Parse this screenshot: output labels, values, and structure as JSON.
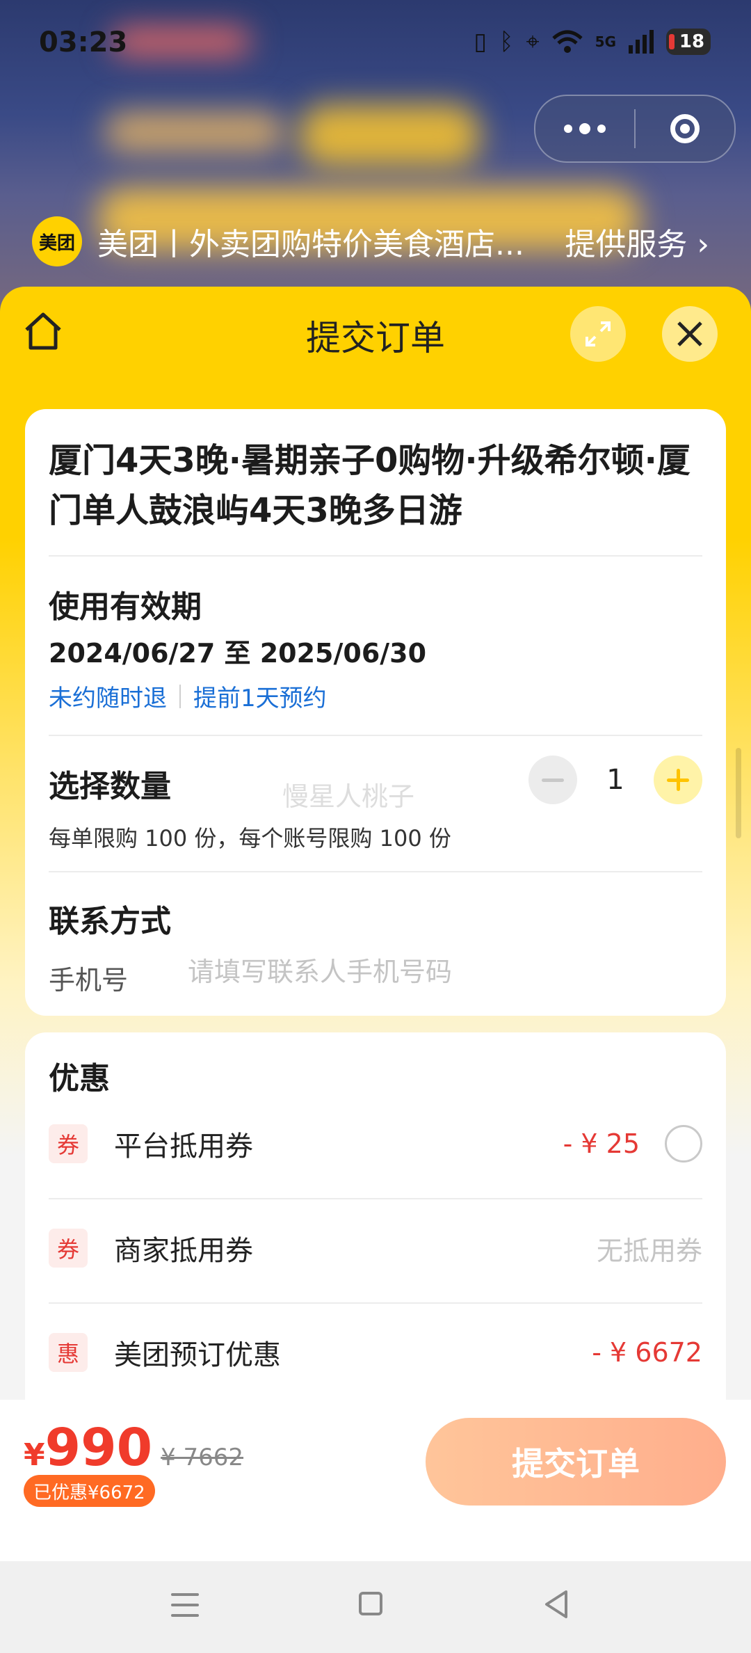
{
  "status_bar": {
    "time": "03:23",
    "network": "5G",
    "battery": "18"
  },
  "provider": {
    "logo_text": "美团",
    "name": "美团丨外卖团购特价美食酒店...",
    "service_link": "提供服务 ›"
  },
  "sheet": {
    "title": "提交订单"
  },
  "product": {
    "title": "厦门4天3晚·暑期亲子0购物·升级希尔顿·厦门单人鼓浪屿4天3晚多日游"
  },
  "validity": {
    "heading": "使用有效期",
    "dates": "2024/06/27 至 2025/06/30",
    "tag_refund": "未约随时退",
    "tag_booking": "提前1天预约"
  },
  "quantity": {
    "heading": "选择数量",
    "value": "1",
    "limit_text": "每单限购 100 份，每个账号限购 100 份",
    "watermark": "慢星人桃子"
  },
  "contact": {
    "heading": "联系方式",
    "phone_label": "手机号",
    "phone_placeholder": "请填写联系人手机号码",
    "phone_value": ""
  },
  "promotions": {
    "heading": "优惠",
    "items": [
      {
        "badge": "券",
        "label": "平台抵用券",
        "value": "- ¥ 25"
      },
      {
        "badge": "券",
        "label": "商家抵用券",
        "value": "无抵用券"
      },
      {
        "badge": "惠",
        "label": "美团预订优惠",
        "value": "- ¥ 6672"
      }
    ]
  },
  "checkout": {
    "currency": "¥",
    "price": "990",
    "original_price": "¥ 7662",
    "saved_badge": "已优惠¥6672",
    "submit_label": "提交订单"
  },
  "colors": {
    "brand_yellow": "#ffd100",
    "price_red": "#f03b2b",
    "link_blue": "#1a6fd6",
    "submit_gradient_start": "#ffc59a"
  }
}
